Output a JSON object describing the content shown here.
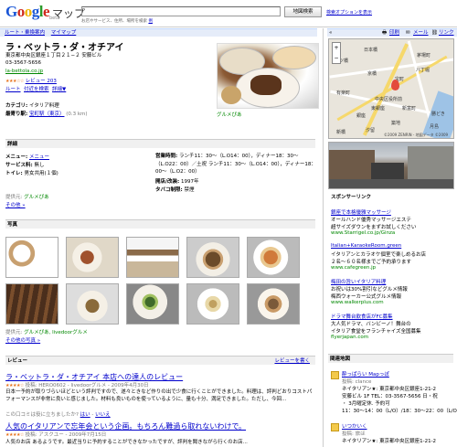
{
  "header": {
    "logo": "Google",
    "logo_maps": "マップ",
    "beta": "beta",
    "search_value": "",
    "search_button": "地図検索",
    "search_hint": "お店やサービス、住所、場所を検索",
    "search_hint_link": "例",
    "advanced_link": "検索オプションを表示"
  },
  "nav": {
    "route": "ルート・乗換案内",
    "mymaps": "マイマップ"
  },
  "tools": {
    "print": "印刷",
    "mail": "メール",
    "link": "リンク"
  },
  "place": {
    "name": "ラ・ベットラ・ダ・オチアイ",
    "address": "東京都中央区銀座１丁目２１−２ 安藤ビル",
    "phone": "03-3567-5656",
    "url": "la-bettola.co.jp",
    "stars": "★★★☆☆",
    "reviews": "レビュー 203",
    "action_route": "ルート",
    "action_nearby": "付近を検索",
    "action_more": "詳細▼",
    "category_label": "カテゴリ:",
    "category": "イタリア料理",
    "station_label": "最寄り駅:",
    "station": "宝町駅（東京）",
    "distance": "(0.3 km)",
    "photo_credit": "グルメぴあ"
  },
  "details": {
    "title": "詳細",
    "menu_label": "メニュー:",
    "menu": "メニュー",
    "service_label": "サービス料:",
    "service": "無し",
    "toilet_label": "トイレ:",
    "toilet": "男女共用(１個)",
    "hours_label": "営業時間:",
    "hours": "ランチ11：30〜（L.O14：00），ディナー18：30〜（L.O22：00）／土祝 ランチ11：30〜（L.O14：00），ディナー18：00〜（L.O2：00）",
    "opened_label": "開店/改装:",
    "opened": "1997年",
    "smoking_label": "タバコ制限:",
    "smoking": "禁煙",
    "source_prefix": "提供元:",
    "source": "グルメぴあ",
    "more": "その他 »"
  },
  "photos": {
    "title": "写真",
    "source_prefix": "提供元:",
    "source": "グルメぴあ, livedoorグルメ",
    "more": "その他の写真 »"
  },
  "reviews": {
    "title": "レビュー",
    "write": "レビューを書く",
    "items": [
      {
        "title": "ラ・ベットラ・ダ・オチアイ 本店への達人のレビュー",
        "stars": "★★★★☆",
        "meta": "投稿: HERO0602 - livedoorグルメ - 2009年4月30日",
        "body1": "日本一予約が取りづらいほどという評判ですので、遂々ときなど作りの出で少食に行くことができました。料理は、評判どおりコストパフォーマンスが非常に良いと感じました。材料も良いものを使っているように、量も十分、満足できました。ただし、今回...",
        "helpful": "この口コミは役に立ちましたか?",
        "yes": "はい",
        "no": "いいえ"
      },
      {
        "title": "人気のイタリアンで忘年会という企画。もちろん難過ら取れないわけで。",
        "stars": "★★★★☆",
        "meta": "投稿: アスクユー - 2009年7月15日",
        "body1": "人気のお店 あるようです。最近当りに予約することができなかったですが、評判を聞きながら行くのお店..."
      }
    ]
  },
  "sidebar": {
    "sponsor_title": "スポンサーリンク",
    "ads": [
      {
        "title": "銀座で本格優雅マッサージ",
        "l1": "オールハンド優秀マッサージエステ",
        "l2": "超サイズダウンをまずお試しください",
        "url": "www.Starrigel.co.jp/Ginza"
      },
      {
        "title": "Italian+KaraokeRoom.green",
        "l1": "イタリアンとカラオケ個室で楽しめるお店",
        "l2": "２名〜６０名様までご予約承ります",
        "url": "www.cafegreen.jp"
      },
      {
        "title": "梅田の旨いイタリア料理",
        "l1": "お祝いは30%割引などグルメ情報",
        "l2": "梅西ウォーカー公式グルメ情報",
        "url": "www.walkerplus.com"
      },
      {
        "title": "ドラマ舞台飲食店がFC募集",
        "l1": "大人気ドラマ、バンビーノ！舞台の",
        "l2": "イタリア食堂をフランチャイズ全国募集",
        "url": "flyerjapan.com"
      }
    ],
    "related_title": "関連地図",
    "related": [
      {
        "title": "酔っぱらい Mapっぽ",
        "by": "投稿: clance",
        "l1": "ネイタリアン★: 東京都中央区銀座1-21-2",
        "l2": "安藤ビル 1F TEL：03-3567-5656 日・祝",
        "l3": "・ 3月曜定休. 予約可",
        "l4": "11：30〜14：00（L/O）/18：30〜22：00（L/O）"
      },
      {
        "title": "いつかいく",
        "by": "投稿: 旅ほ",
        "l1": "ネイタリアン★: 東京都中央区銀座1-21-2"
      }
    ],
    "map_labels": [
      "日本橋",
      "中央区役所前",
      "新富町",
      "銀座",
      "月島",
      "新橋",
      "汐留",
      "築地",
      "宝町",
      "京橋",
      "八丁堀",
      "勝どき",
      "一ツ橋",
      "東銀座",
      "有楽町",
      "茅場町"
    ],
    "map_copyright": "©2009 ZENRIN - 地図データ ©2009"
  }
}
